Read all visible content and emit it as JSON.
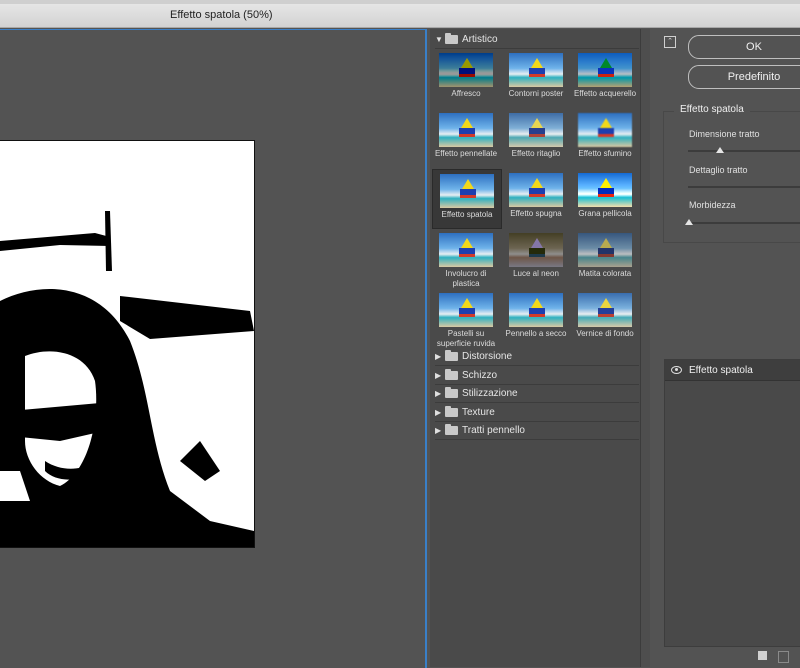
{
  "window": {
    "title": "Effetto spatola (50%)"
  },
  "gallery": {
    "categories": [
      {
        "label": "Artistico",
        "expanded": true
      },
      {
        "label": "Distorsione",
        "expanded": false
      },
      {
        "label": "Schizzo",
        "expanded": false
      },
      {
        "label": "Stilizzazione",
        "expanded": false
      },
      {
        "label": "Texture",
        "expanded": false
      },
      {
        "label": "Tratti pennello",
        "expanded": false
      }
    ],
    "filters": [
      {
        "label": "Affresco"
      },
      {
        "label": "Contorni poster"
      },
      {
        "label": "Effetto acquerello"
      },
      {
        "label": "Effetto pennellate"
      },
      {
        "label": "Effetto ritaglio"
      },
      {
        "label": "Effetto sfumino"
      },
      {
        "label": "Effetto spatola",
        "selected": true
      },
      {
        "label": "Effetto spugna"
      },
      {
        "label": "Grana pellicola"
      },
      {
        "label": "Involucro di plastica"
      },
      {
        "label": "Luce al neon"
      },
      {
        "label": "Matita colorata"
      },
      {
        "label": "Pastelli su superficie ruvida"
      },
      {
        "label": "Pennello a secco"
      },
      {
        "label": "Vernice di fondo"
      }
    ]
  },
  "buttons": {
    "ok": "OK",
    "default": "Predefinito"
  },
  "options": {
    "title": "Effetto spatola",
    "sliders": [
      {
        "label": "Dimensione tratto",
        "value_fraction": 0.28
      },
      {
        "label": "Dettaglio tratto",
        "value_fraction": 1.0
      },
      {
        "label": "Morbidezza",
        "value_fraction": 0.0
      }
    ]
  },
  "layers": {
    "items": [
      {
        "name": "Effetto spatola",
        "visible": true
      }
    ]
  },
  "colors": {
    "accent": "#3a80c8",
    "panel": "#535353",
    "gallery": "#4a4a4a"
  }
}
